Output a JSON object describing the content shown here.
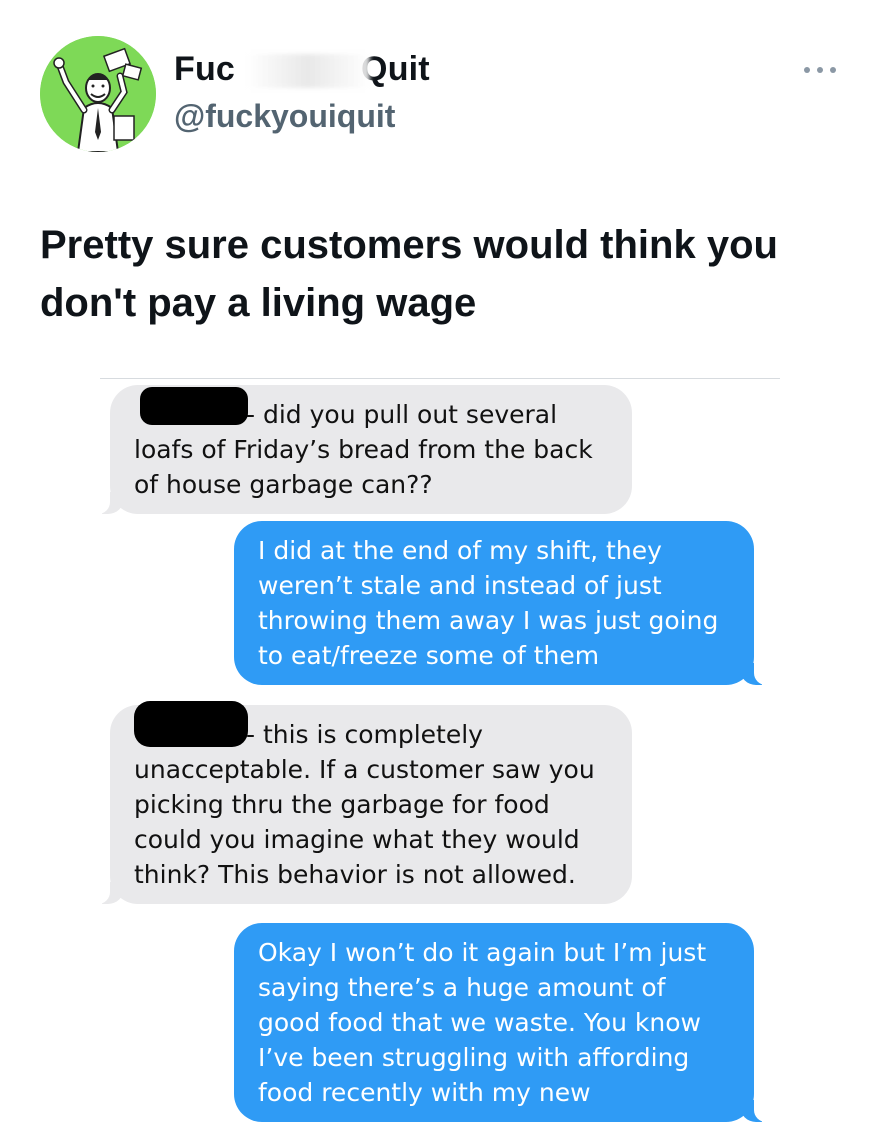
{
  "tweet": {
    "display_name_start": "Fuc",
    "display_name_end": "Quit",
    "handle": "@fuckyouiquit",
    "text": "Pretty sure customers would think you don't pay a living wage",
    "more_icon": "more-horizontal-icon",
    "avatar_icon": "cartoon-man-quitting-avatar",
    "avatar_color": "#7ed957"
  },
  "conversation": {
    "messages": [
      {
        "direction": "incoming",
        "text": "- did you pull out several\nloafs of Friday’s bread from the back\nof house garbage can??"
      },
      {
        "direction": "outgoing",
        "text": "I did at the end of my shift, they weren’t stale and instead of just throwing them away I was just going to eat/freeze some of them"
      },
      {
        "direction": "incoming",
        "text": "- this is completely\nunacceptable. If a customer saw you picking thru the garbage for food could you imagine what they would think? This behavior is not allowed."
      },
      {
        "direction": "outgoing",
        "text": "Okay I won’t do it again but I’m just saying there’s a huge amount of good food that we waste. You know I’ve been struggling with affording food recently with my new"
      }
    ],
    "incoming_color": "#e9e9eb",
    "outgoing_color": "#2f9bf5"
  }
}
